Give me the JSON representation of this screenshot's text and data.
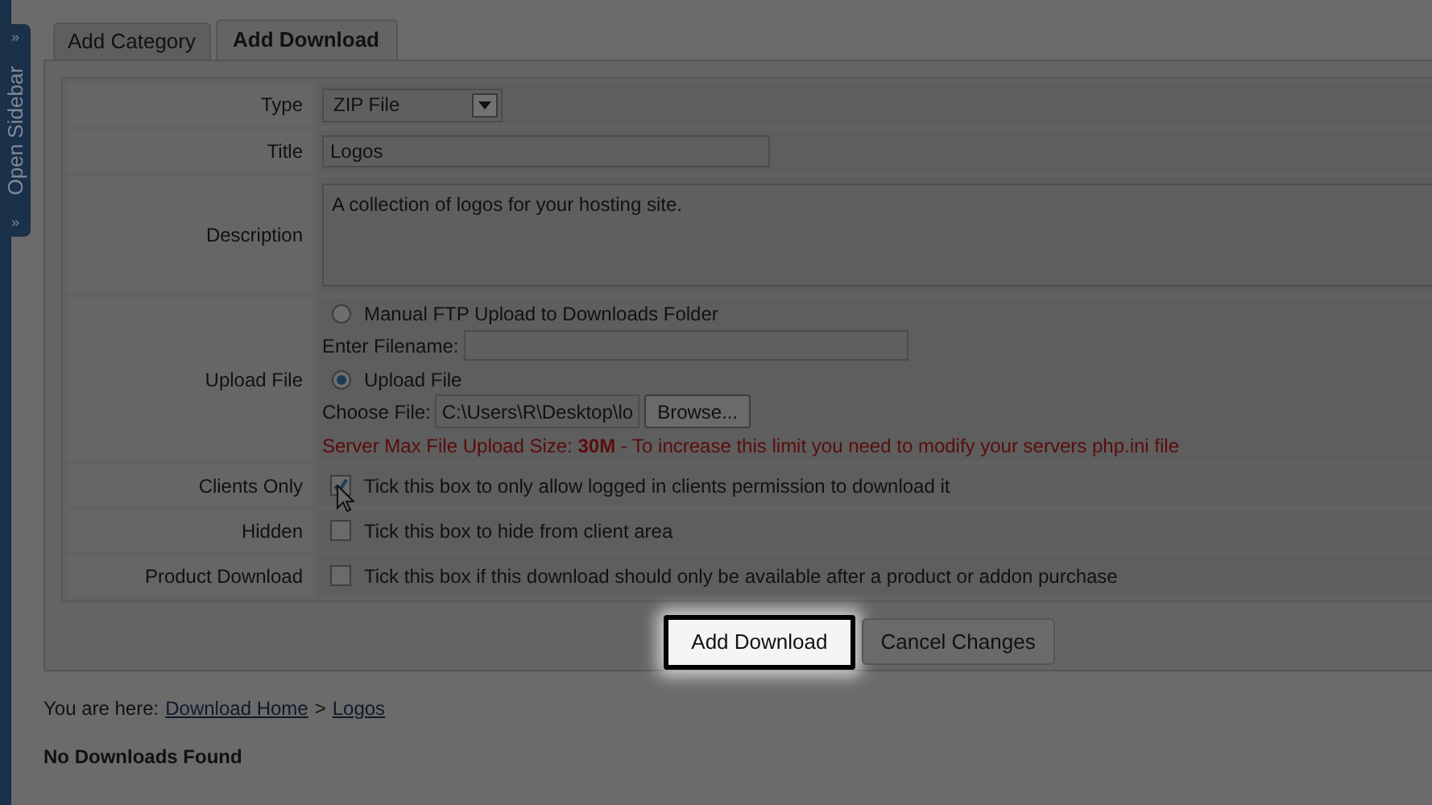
{
  "sidebar_toggle": {
    "label": "Open Sidebar",
    "top_mark": "»",
    "bottom_mark": "»"
  },
  "tabs": [
    {
      "label": "Add Category",
      "selected": false
    },
    {
      "label": "Add Download",
      "selected": true
    }
  ],
  "form": {
    "fields": [
      {
        "kind": "select",
        "label": "Type",
        "value": "ZIP File"
      },
      {
        "kind": "text",
        "label": "Title",
        "value": "Logos"
      },
      {
        "kind": "textarea",
        "label": "Description",
        "value": "A collection of logos for your hosting site."
      },
      {
        "kind": "upload",
        "label": "Upload File",
        "options": [
          {
            "label": "Manual FTP Upload to Downloads Folder",
            "selected": false,
            "field_label": "Enter Filename:"
          },
          {
            "label": "Upload File",
            "selected": true,
            "field_label": "Choose File:",
            "value": "C:\\Users\\R\\Desktop\\lo",
            "browse": "Browse..."
          }
        ],
        "note": "Server Max File Upload Size: **30M** - To increase this limit you need to modify your servers php.ini file"
      },
      {
        "kind": "checkbox",
        "label": "Clients Only",
        "checked": true,
        "text": "Tick this box to only allow logged in clients permission to download it"
      },
      {
        "kind": "checkbox",
        "label": "Hidden",
        "checked": false,
        "text": "Tick this box to hide from client area"
      },
      {
        "kind": "checkbox",
        "label": "Product Download",
        "checked": false,
        "text": "Tick this box if this download should only be available after a product or addon purchase"
      }
    ]
  },
  "buttons": [
    {
      "label": "Add Download",
      "highlighted": true
    },
    {
      "label": "Cancel Changes",
      "highlighted": false
    }
  ],
  "breadcrumb": {
    "prefix": "You are here:",
    "links": [
      "Download Home",
      "Logos"
    ],
    "separator": ">"
  },
  "empty_message": "No Downloads Found"
}
